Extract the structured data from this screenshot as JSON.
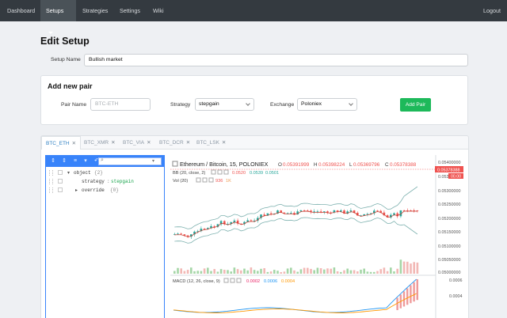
{
  "nav": {
    "items": [
      "Dashboard",
      "Setups",
      "Strategies",
      "Settings",
      "Wiki"
    ],
    "active": "Setups",
    "logout": "Logout"
  },
  "page": {
    "title": "Edit Setup",
    "setup_name_label": "Setup Name",
    "setup_name_value": "Bullish market"
  },
  "add_pair": {
    "title": "Add new pair",
    "pair_name_label": "Pair Name",
    "pair_name_placeholder": "BTC-ETH",
    "strategy_label": "Strategy",
    "strategy_value": "stepgain",
    "exchange_label": "Exchange",
    "exchange_value": "Poloniex",
    "button": "Add Pair"
  },
  "tabs": [
    "BTC_ETH",
    "BTC_XMR",
    "BTC_VIA",
    "BTC_DCR",
    "BTC_LSK"
  ],
  "active_tab": "BTC_ETH",
  "json_editor": {
    "root_key": "object",
    "root_count": "{2}",
    "rows": [
      {
        "key": "strategy",
        "value": "stepgain"
      },
      {
        "key": "override",
        "value": "{0}"
      }
    ]
  },
  "chart": {
    "title": "Ethereum / Bitcoin, 15, POLONIEX",
    "ohlc": {
      "O": "0.05391999",
      "H": "0.05398224",
      "L": "0.05369796",
      "C": "0.05378388"
    },
    "bb_label": "BB (20, close, 2)",
    "bb_values": [
      "0.0520",
      "0.0539",
      "0.0501"
    ],
    "vol_label": "Vol (20)",
    "vol_values": [
      "936",
      "1K"
    ],
    "macd_label": "MACD (12, 26, close, 9)",
    "macd_values": [
      "0.0002",
      "0.0006",
      "0.0004"
    ],
    "price_axis": [
      "0.05400000",
      "0.05350000",
      "0.05300000",
      "0.05250000",
      "0.05200000",
      "0.05150000",
      "0.05100000",
      "0.05050000",
      "0.05000000"
    ],
    "last_price": "0.05378388",
    "last_tag": "00.00",
    "macd_axis": [
      "0.0006",
      "0.0004"
    ],
    "colors": {
      "up": "#26a69a",
      "down": "#ef5350",
      "bb": "#7fb2b0",
      "macd": "#2196f3",
      "signal": "#ff9800"
    }
  }
}
